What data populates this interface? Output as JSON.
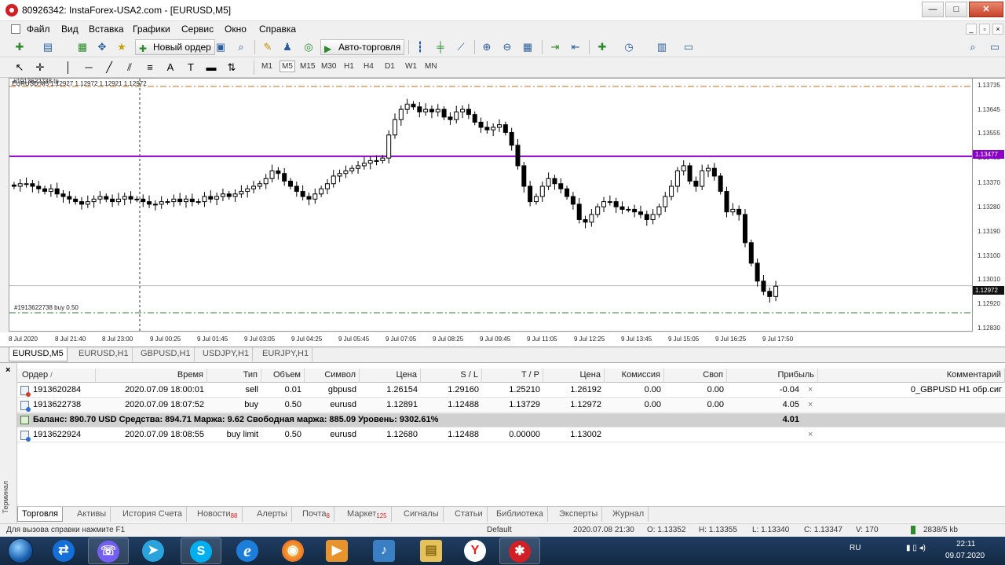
{
  "window": {
    "title": "80926342: InstaForex-USA2.com - [EURUSD,M5]",
    "buttons": {
      "minimize": "—",
      "maximize": "□",
      "close": "✕"
    }
  },
  "menu": {
    "items": [
      "Файл",
      "Вид",
      "Вставка",
      "Графики",
      "Сервис",
      "Окно",
      "Справка"
    ],
    "mdi_buttons": [
      "_",
      "▫",
      "×"
    ]
  },
  "toolbar": {
    "new_order": "Новый ордер",
    "auto_trading": "Авто-торговля",
    "timeframes": [
      "M1",
      "M5",
      "M15",
      "M30",
      "H1",
      "H4",
      "D1",
      "W1",
      "MN"
    ],
    "active_timeframe": "M5"
  },
  "chart": {
    "info_line": "EURUSD,M5  1.12927 1.12972 1.12921 1.12972",
    "tp_label": "#1913622738 tp",
    "buy_label": "#1913622738 buy 0.50",
    "price_ticks": [
      "1.13735",
      "1.13645",
      "1.13555",
      "1.13465",
      "1.13370",
      "1.13280",
      "1.13190",
      "1.13100",
      "1.13010",
      "1.12920",
      "1.12830"
    ],
    "price_tags": {
      "hline": "1.13477",
      "current": "1.12972"
    },
    "time_ticks": [
      "8 Jul 2020",
      "8 Jul 21:40",
      "8 Jul 23:00",
      "9 Jul 00:25",
      "9 Jul 01:45",
      "9 Jul 03:05",
      "9 Jul 04:25",
      "9 Jul 05:45",
      "9 Jul 07:05",
      "9 Jul 08:25",
      "9 Jul 09:45",
      "9 Jul 11:05",
      "9 Jul 12:25",
      "9 Jul 13:45",
      "9 Jul 15:05",
      "9 Jul 16:25",
      "9 Jul 17:50"
    ],
    "colors": {
      "hline": "#8b00c9",
      "tp_line": "#d2691e",
      "buy_line": "#2e7d32",
      "bull": "#ffffff",
      "bear": "#000000"
    }
  },
  "chart_data": {
    "type": "candlestick",
    "symbol": "EURUSD",
    "timeframe": "M5",
    "ylim": [
      1.1279,
      1.1378
    ],
    "series": [
      {
        "values": [
          1.1336,
          1.1337,
          1.1337,
          1.1336,
          1.1335,
          1.1334,
          1.1335,
          1.1333,
          1.1332,
          1.1331,
          1.133,
          1.1329,
          1.133,
          1.1331,
          1.1332,
          1.1331,
          1.133,
          1.1331,
          1.1332,
          1.1331,
          1.1331,
          1.133,
          1.1329,
          1.1329,
          1.133,
          1.133,
          1.1331,
          1.133,
          1.1331,
          1.133,
          1.133,
          1.1332,
          1.1331,
          1.1332,
          1.1333,
          1.1332,
          1.1333,
          1.1334,
          1.1335,
          1.1336,
          1.1337,
          1.1339,
          1.1342,
          1.1341,
          1.1338,
          1.1336,
          1.1334,
          1.1332,
          1.1331,
          1.1333,
          1.1335,
          1.1337,
          1.134,
          1.1341,
          1.1342,
          1.1343,
          1.1344,
          1.1345,
          1.1346,
          1.1346,
          1.1347,
          1.1356,
          1.1362,
          1.1366,
          1.1368,
          1.1367,
          1.1365,
          1.1366,
          1.1365,
          1.1366,
          1.1363,
          1.1362,
          1.1365,
          1.1366,
          1.1364,
          1.1361,
          1.1359,
          1.1358,
          1.1359,
          1.136,
          1.1357,
          1.1352,
          1.1344,
          1.1336,
          1.133,
          1.1332,
          1.1336,
          1.1339,
          1.1337,
          1.1335,
          1.1332,
          1.1329,
          1.1323,
          1.1322,
          1.1325,
          1.1328,
          1.133,
          1.133,
          1.1328,
          1.1327,
          1.1327,
          1.1326,
          1.1325,
          1.1323,
          1.1325,
          1.1328,
          1.1332,
          1.1336,
          1.1342,
          1.1344,
          1.1338,
          1.1336,
          1.1342,
          1.1343,
          1.134,
          1.1334,
          1.1326,
          1.1327,
          1.1325,
          1.1314,
          1.1306,
          1.1299,
          1.1295,
          1.1293,
          1.1297
        ]
      }
    ],
    "horizontal_lines": [
      1.13477
    ],
    "last_price": 1.12972
  },
  "chart_tabs": [
    "EURUSD,M5",
    "EURUSD,H1",
    "GBPUSD,H1",
    "USDJPY,H1",
    "EURJPY,H1"
  ],
  "terminal": {
    "close_label": "×",
    "side_label": "Терминал",
    "columns": [
      "Ордер",
      "Время",
      "Тип",
      "Объем",
      "Символ",
      "Цена",
      "S / L",
      "T / P",
      "Цена",
      "Комиссия",
      "Своп",
      "Прибыль",
      "Комментарий"
    ],
    "sort_indicator": "/",
    "rows": [
      {
        "order": "1913620284",
        "time": "2020.07.09 18:00:01",
        "type": "sell",
        "volume": "0.01",
        "symbol": "gbpusd",
        "price": "1.26154",
        "sl": "1.29160",
        "tp": "1.25210",
        "cur": "1.26192",
        "commission": "0.00",
        "swap": "0.00",
        "profit": "-0.04",
        "comment": "0_GBPUSD H1 обр.сиг"
      },
      {
        "order": "1913622738",
        "time": "2020.07.09 18:07:52",
        "type": "buy",
        "volume": "0.50",
        "symbol": "eurusd",
        "price": "1.12891",
        "sl": "1.12488",
        "tp": "1.13729",
        "cur": "1.12972",
        "commission": "0.00",
        "swap": "0.00",
        "profit": "4.05",
        "comment": ""
      }
    ],
    "summary": {
      "text": "Баланс: 890.70 USD  Средства: 894.71  Маржа: 9.62  Свободная маржа: 885.09  Уровень: 9302.61%",
      "profit": "4.01"
    },
    "pending": {
      "order": "1913622924",
      "time": "2020.07.09 18:08:55",
      "type": "buy limit",
      "volume": "0.50",
      "symbol": "eurusd",
      "price": "1.12680",
      "sl": "1.12488",
      "tp": "0.00000",
      "cur": "1.13002"
    },
    "x_mark": "×",
    "tabs": [
      {
        "label": "Торговля",
        "badge": ""
      },
      {
        "label": "Активы",
        "badge": ""
      },
      {
        "label": "История Счета",
        "badge": ""
      },
      {
        "label": "Новости",
        "badge": "88"
      },
      {
        "label": "Алерты",
        "badge": ""
      },
      {
        "label": "Почта",
        "badge": "8"
      },
      {
        "label": "Маркет",
        "badge": "125"
      },
      {
        "label": "Сигналы",
        "badge": ""
      },
      {
        "label": "Статьи",
        "badge": ""
      },
      {
        "label": "Библиотека",
        "badge": ""
      },
      {
        "label": "Эксперты",
        "badge": ""
      },
      {
        "label": "Журнал",
        "badge": ""
      }
    ]
  },
  "status": {
    "help": "Для вызова справки нажмите F1",
    "profile": "Default",
    "datetime": "2020.07.08 21:30",
    "open": "O: 1.13352",
    "high": "H: 1.13355",
    "low": "L: 1.13340",
    "close": "C: 1.13347",
    "volume": "V: 170",
    "traffic": "2838/5 kb"
  },
  "taskbar": {
    "apps": [
      "teamviewer-icon",
      "viber-icon",
      "telegram-icon",
      "skype-icon",
      "ie-icon",
      "firefox-icon",
      "media-icon",
      "audio-icon",
      "explorer-icon",
      "yandex-icon",
      "metatrader-icon"
    ],
    "lang": "RU",
    "time": "22:11",
    "date": "09.07.2020",
    "glyphs": {
      "teamviewer": "⇄",
      "viber": "☏",
      "telegram": "➤",
      "skype": "S",
      "ie": "e",
      "firefox": "◉",
      "media": "▶",
      "audio": "♪",
      "explorer": "▤",
      "yandex": "Y",
      "metatrader": "✱"
    }
  }
}
